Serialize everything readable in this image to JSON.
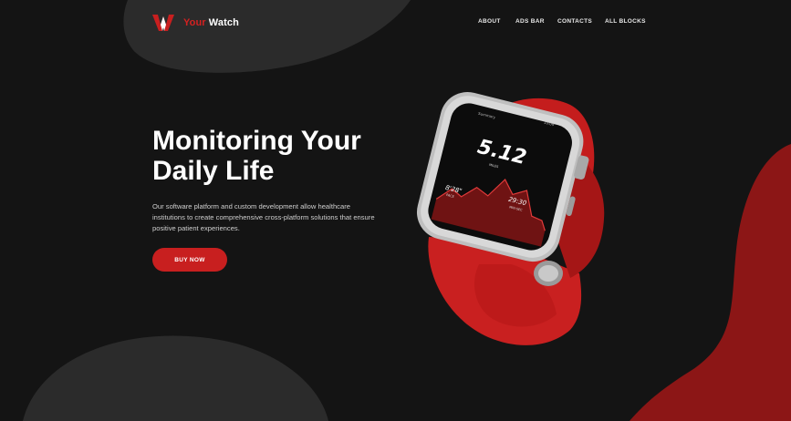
{
  "brand": {
    "name_accent": "Your",
    "name_rest": " Watch",
    "logo_icon": "w-logo-icon"
  },
  "nav": {
    "items": [
      "ABOUT",
      "ADS BAR",
      "CONTACTS",
      "ALL BLOCKS"
    ]
  },
  "hero": {
    "title_line1": "Monitoring Your",
    "title_line2": "Daily Life",
    "description": "Our software platform and custom development allow healthcare institutions to create comprehensive cross-platform  solutions that ensure positive patient experiences.",
    "cta_label": "BUY NOW"
  },
  "watch": {
    "top_left": "Summary",
    "top_right": "10:09",
    "distance": "5.12",
    "distance_unit": "MILES",
    "pace": "8'28\"",
    "pace_label": "PACE",
    "time": "29:30",
    "time_label": "MIN:SEC"
  },
  "colors": {
    "background": "#141414",
    "accent": "#c81f1f",
    "blob": "#2a2a2a",
    "text": "#ffffff"
  }
}
